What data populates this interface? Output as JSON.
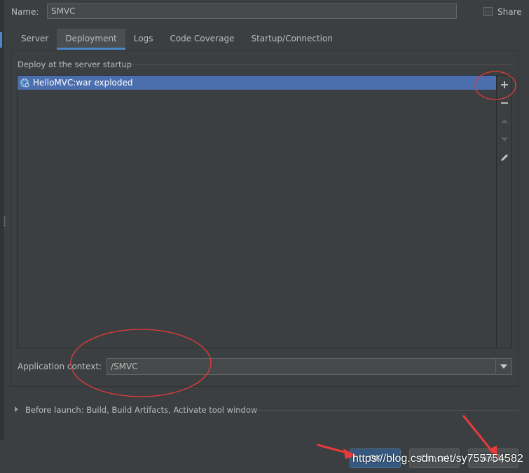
{
  "header": {
    "name_label": "Name:",
    "name_value": "SMVC",
    "share_label": "Share",
    "share_checked": false
  },
  "tabs": [
    {
      "label": "Server",
      "active": false
    },
    {
      "label": "Deployment",
      "active": true
    },
    {
      "label": "Logs",
      "active": false
    },
    {
      "label": "Code Coverage",
      "active": false
    },
    {
      "label": "Startup/Connection",
      "active": false
    }
  ],
  "deployment": {
    "section_title": "Deploy at the server startup",
    "items": [
      {
        "label": "HelloMVC:war exploded",
        "icon": "war-exploded-artifact-icon",
        "selected": true
      }
    ],
    "toolbar": {
      "add_icon": "plus-icon",
      "remove_icon": "minus-icon",
      "move_up_icon": "arrow-up-icon",
      "move_down_icon": "arrow-down-icon",
      "edit_icon": "pencil-icon"
    },
    "context_label": "Application context:",
    "context_value": "/SMVC"
  },
  "before_launch": {
    "label": "Before launch: Build, Build Artifacts, Activate tool window"
  },
  "buttons": {
    "ok": "OK",
    "cancel": "Cancel",
    "apply": "Apply"
  },
  "watermark": "https://blog.csdn.net/sy755754582",
  "colors": {
    "background": "#3c3f41",
    "selection": "#4b6eaf",
    "accent": "#4a88c7",
    "annotation": "#e83a3a"
  }
}
